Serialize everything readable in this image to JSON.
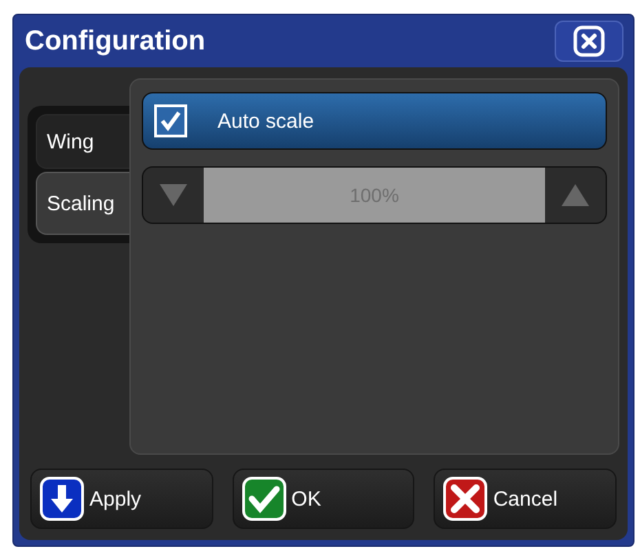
{
  "window": {
    "title": "Configuration"
  },
  "tabs": [
    {
      "label": "Wing",
      "selected": false
    },
    {
      "label": "Scaling",
      "selected": true
    }
  ],
  "auto_scale": {
    "label": "Auto scale",
    "checked": true
  },
  "scale_spinner": {
    "value": "100%"
  },
  "buttons": [
    {
      "label": "Apply",
      "kind": "apply"
    },
    {
      "label": "OK",
      "kind": "ok"
    },
    {
      "label": "Cancel",
      "kind": "cancel"
    }
  ]
}
